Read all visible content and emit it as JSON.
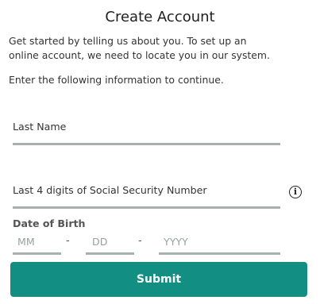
{
  "page": {
    "title": "Create Account",
    "intro_line1": "Get started by telling us about you. To set up an",
    "intro_line2": "online account, we need to locate you in our system.",
    "instructions": "Enter the following information to continue."
  },
  "form": {
    "last_name_label": "Last Name",
    "ssn_label": "Last 4 digits of Social Security Number",
    "info_icon_glyph": "i",
    "dob_label": "Date of Birth",
    "month_placeholder": "MM",
    "day_placeholder": "DD",
    "year_placeholder": "YYYY",
    "separator": "-",
    "submit_label": "Submit"
  },
  "colors": {
    "submit_background": "#128e83",
    "field_underline": "#a9b1b0",
    "placeholder": "#9aa0a0"
  },
  "icons": {
    "info": "info-circle-icon"
  }
}
